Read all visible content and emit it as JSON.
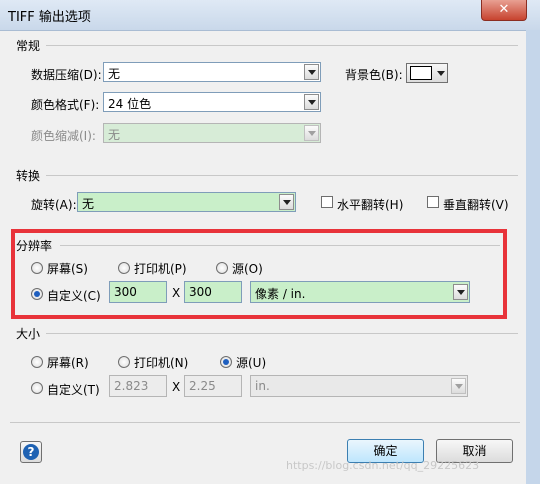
{
  "window": {
    "title": "TIFF 输出选项",
    "close_label": "✕"
  },
  "general": {
    "label": "常规",
    "compression": {
      "label": "数据压缩(D):",
      "value": "无"
    },
    "color_format": {
      "label": "颜色格式(F):",
      "value": "24 位色"
    },
    "color_reduction": {
      "label": "颜色缩减(I):",
      "value": "无"
    },
    "background": {
      "label": "背景色(B):",
      "color": "#ffffff"
    }
  },
  "transform": {
    "label": "转换",
    "rotation": {
      "label": "旋转(A):",
      "value": "无"
    },
    "flip_h": {
      "label": "水平翻转(H)",
      "checked": false
    },
    "flip_v": {
      "label": "垂直翻转(V)",
      "checked": false
    }
  },
  "resolution": {
    "label": "分辨率",
    "screen": "屏幕(S)",
    "printer": "打印机(P)",
    "source": "源(O)",
    "custom": "自定义(C)",
    "width": "300",
    "x": "X",
    "height": "300",
    "unit": "像素 / in.",
    "selected": "custom"
  },
  "size": {
    "label": "大小",
    "screen": "屏幕(R)",
    "printer": "打印机(N)",
    "source": "源(U)",
    "custom": "自定义(T)",
    "width": "2.823",
    "x": "X",
    "height": "2.25",
    "unit": "in.",
    "selected": "source"
  },
  "footer": {
    "help": "?",
    "ok": "确定",
    "cancel": "取消"
  },
  "watermark": "https://blog.csdn.net/qq_29225623",
  "colors": {
    "highlight": "#e8333a",
    "field_green": "#c9efc9"
  }
}
